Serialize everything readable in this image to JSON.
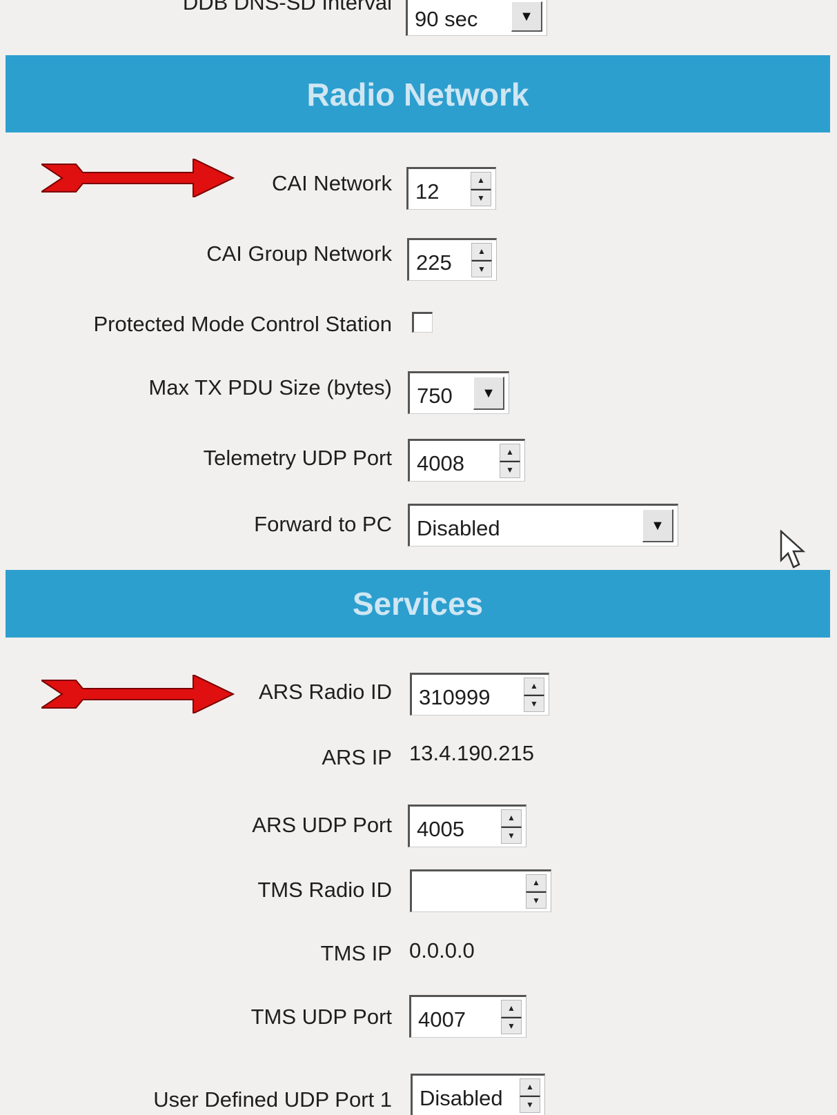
{
  "top": {
    "partial_label": "DDB DNS-SD Interval",
    "interval_value": "90 sec"
  },
  "radio_network": {
    "title": "Radio Network",
    "cai_network_label": "CAI Network",
    "cai_network_value": "12",
    "cai_group_label": "CAI Group Network",
    "cai_group_value": "225",
    "protected_mode_label": "Protected Mode Control Station",
    "protected_mode_checked": false,
    "max_tx_label": "Max TX PDU Size (bytes)",
    "max_tx_value": "750",
    "telemetry_label": "Telemetry UDP Port",
    "telemetry_value": "4008",
    "forward_label": "Forward to PC",
    "forward_value": "Disabled"
  },
  "services": {
    "title": "Services",
    "ars_radio_id_label": "ARS Radio ID",
    "ars_radio_id_value": "310999",
    "ars_ip_label": "ARS IP",
    "ars_ip_value": "13.4.190.215",
    "ars_udp_label": "ARS UDP Port",
    "ars_udp_value": "4005",
    "tms_radio_id_label": "TMS Radio ID",
    "tms_radio_id_value": "",
    "tms_ip_label": "TMS IP",
    "tms_ip_value": "0.0.0.0",
    "tms_udp_label": "TMS UDP Port",
    "tms_udp_value": "4007",
    "user_defined_label": "User Defined UDP Port 1",
    "user_defined_value": "Disabled"
  },
  "colors": {
    "banner": "#2c9fcf",
    "arrow": "#e01010"
  },
  "icons": [
    "spinner-up-down-icon",
    "dropdown-arrow-icon",
    "red-arrow-icon",
    "mouse-cursor-icon"
  ]
}
